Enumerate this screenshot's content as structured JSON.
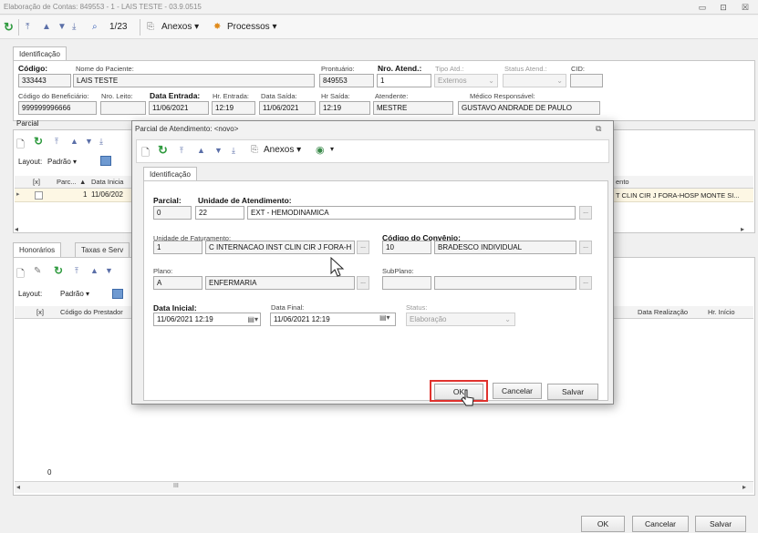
{
  "window": {
    "title": "Elaboração de Contas: 849553 - 1 - LAIS TESTE - 03.9.0515",
    "controls": [
      "▭",
      "⊡",
      "☒"
    ]
  },
  "toolbar": {
    "refresh_icon": "refresh-icon",
    "record_counter": "1/23",
    "anexos_label": "Anexos",
    "processos_label": "Processos"
  },
  "main_tab": {
    "label": "Identificação"
  },
  "identificacao": {
    "codigo_label": "Código:",
    "codigo_value": "333443",
    "nome_label": "Nome do Paciente:",
    "nome_value": "LAIS TESTE",
    "prontuario_label": "Prontuário:",
    "prontuario_value": "849553",
    "nro_atend_label": "Nro. Atend.:",
    "nro_atend_value": "1",
    "tipo_atd_label": "Tipo Atd.:",
    "tipo_atd_value": "Externos",
    "status_atend_label": "Status Atend.:",
    "cid_label": "CID:",
    "cod_benef_label": "Código do Beneficiário:",
    "cod_benef_value": "999999996666",
    "nro_leito_label": "Nro. Leito:",
    "data_entrada_label": "Data Entrada:",
    "data_entrada_value": "11/06/2021",
    "hr_entrada_label": "Hr. Entrada:",
    "hr_entrada_value": "12:19",
    "data_saida_label": "Data Saída:",
    "data_saida_value": "11/06/2021",
    "hr_saida_label": "Hr Saída:",
    "hr_saida_value": "12:19",
    "atendente_label": "Atendente:",
    "atendente_value": "MESTRE",
    "medico_label": "Médico Responsável:",
    "medico_value": "GUSTAVO ANDRADE DE PAULO"
  },
  "parcial_section": {
    "title": "Parcial",
    "layout_label": "Layout:",
    "layout_value": "Padrão",
    "columns": [
      "[x]",
      "Parc...",
      "Data Inicia"
    ],
    "row": {
      "parc": "1",
      "data": "11/06/202"
    },
    "right_header": "ento",
    "right_cell": "T CLIN CIR J FORA-HOSP MONTE SI..."
  },
  "lower_section": {
    "tabs": [
      "Honorários",
      "Taxas e Serv"
    ],
    "layout_label": "Layout:",
    "layout_value": "Padrão",
    "columns": [
      "[x]",
      "Código do Prestador"
    ],
    "right_columns": [
      "Data Realização",
      "Hr. Início"
    ],
    "footer_count": "0",
    "scroll_mark": "III"
  },
  "bottom_buttons": {
    "ok": "OK",
    "cancelar": "Cancelar",
    "salvar": "Salvar"
  },
  "dialog": {
    "title": "Parcial de Atendimento: <novo>",
    "anexos_label": "Anexos",
    "tab": "Identificação",
    "parcial_label": "Parcial:",
    "parcial_value": "0",
    "unidade_atend_label": "Unidade de Atendimento:",
    "unidade_atend_code": "22",
    "unidade_atend_desc": "EXT - HEMODINAMICA",
    "unidade_fat_label": "Unidade de Faturamento:",
    "unidade_fat_code": "1",
    "unidade_fat_desc": "C INTERNACAO INST CLIN CIR J FORA-H",
    "cod_convenio_label": "Código do Convênio:",
    "cod_convenio_code": "10",
    "cod_convenio_desc": "BRADESCO INDIVIDUAL",
    "plano_label": "Plano:",
    "plano_code": "A",
    "plano_desc": "ENFERMARIA",
    "subplano_label": "SubPlano:",
    "data_inicial_label": "Data Inicial:",
    "data_inicial_value": "11/06/2021 12:19",
    "data_final_label": "Data Final:",
    "data_final_value": "11/06/2021 12:19",
    "status_label": "Status:",
    "status_value": "Elaboração",
    "ok_label": "OK",
    "cancelar_label": "Cancelar",
    "salvar_label": "Salvar"
  },
  "colors": {
    "highlight": "#e0322e",
    "refresh_green": "#2e9a3e",
    "selected_row": "#fdf7e4"
  }
}
